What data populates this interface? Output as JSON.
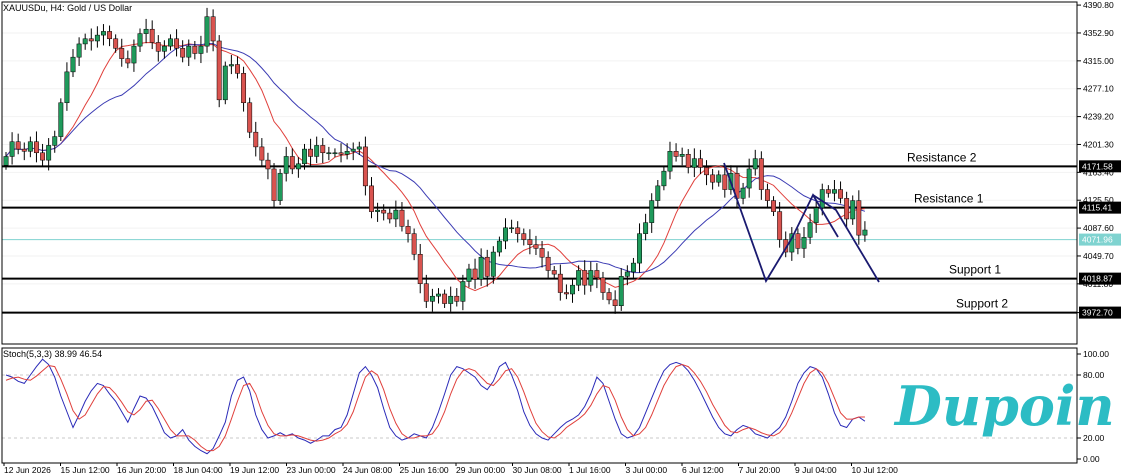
{
  "chart_data": {
    "type": "candlestick",
    "symbol": "XAUUSDu",
    "timeframe": "H4",
    "title": "Gold / US Dollar",
    "ylim": [
      3930,
      4395
    ],
    "y_ticks": [
      "4390.80",
      "4352.90",
      "4315.00",
      "4277.10",
      "4239.20",
      "4201.30",
      "4163.40",
      "4125.50",
      "4087.60",
      "4049.70",
      "4011.80",
      "3972.70"
    ],
    "x_labels": [
      "12 Jun 2026",
      "15 Jun 12:00",
      "16 Jun 20:00",
      "18 Jun 04:00",
      "19 Jun 12:00",
      "23 Jun 00:00",
      "24 Jun 08:00",
      "25 Jun 16:00",
      "29 Jun 00:00",
      "30 Jun 08:00",
      "1 Jul 16:00",
      "3 Jul 00:00",
      "6 Jul 12:00",
      "7 Jul 20:00",
      "9 Jul 04:00",
      "10 Jul 12:00"
    ],
    "current_price": "4071.96",
    "levels": [
      {
        "name": "Resistance 2",
        "value": 4171.58,
        "label": "4171.58"
      },
      {
        "name": "Resistance 1",
        "value": 4115.41,
        "label": "4115.41"
      },
      {
        "name": "Support 1",
        "value": 4018.87,
        "label": "4018.87"
      },
      {
        "name": "Support 2",
        "value": 3972.7,
        "label": "3972.70"
      }
    ],
    "candles_close": [
      4185,
      4205,
      4195,
      4192,
      4205,
      4190,
      4180,
      4200,
      4212,
      4258,
      4300,
      4320,
      4338,
      4345,
      4342,
      4350,
      4355,
      4345,
      4332,
      4318,
      4312,
      4335,
      4352,
      4358,
      4340,
      4328,
      4335,
      4345,
      4332,
      4320,
      4335,
      4325,
      4335,
      4375,
      4342,
      4262,
      4308,
      4310,
      4298,
      4258,
      4218,
      4198,
      4180,
      4168,
      4125,
      4162,
      4185,
      4168,
      4175,
      4195,
      4185,
      4200,
      4190,
      4190,
      4190,
      4188,
      4192,
      4195,
      4198,
      4145,
      4110,
      4112,
      4108,
      4100,
      4112,
      4090,
      4080,
      4052,
      4012,
      3988,
      3995,
      3998,
      3985,
      3995,
      3988,
      4015,
      4032,
      4018,
      4048,
      4022,
      4055,
      4070,
      4088,
      4088,
      4080,
      4072,
      4065,
      4060,
      4048,
      4030,
      4025,
      4000,
      3998,
      4010,
      4030,
      4010,
      4030,
      4020,
      4000,
      3990,
      3982,
      4022,
      4028,
      4040,
      4080,
      4095,
      4125,
      4145,
      4165,
      4192,
      4185,
      4188,
      4170,
      4182,
      4170,
      4160,
      4150,
      4160,
      4140,
      4162,
      4128,
      4142,
      4168,
      4182,
      4140,
      4125,
      4110,
      4072,
      4055,
      4080,
      4060,
      4075,
      4095,
      4115,
      4140,
      4135,
      4140,
      4128,
      4100,
      4125,
      4078,
      4085
    ],
    "ma_fast_name": "MA fast",
    "ma_slow_name": "MA slow",
    "patterns": [
      {
        "name": "zigzag-left",
        "points": [
          [
            124,
            4182
          ],
          [
            130,
            4028
          ],
          [
            135,
            4115
          ],
          [
            138,
            4148
          ],
          [
            143,
            4028
          ]
        ]
      }
    ],
    "stoch": {
      "title": "Stoch(5,3,3) 38.99 46.54",
      "ylim": [
        0,
        100
      ],
      "y_ticks": [
        "100.00",
        "80.00",
        "20.00",
        "0.00"
      ],
      "k": [
        80,
        78,
        74,
        72,
        80,
        88,
        95,
        90,
        78,
        60,
        45,
        30,
        42,
        55,
        65,
        72,
        70,
        62,
        55,
        45,
        35,
        48,
        60,
        58,
        50,
        38,
        25,
        20,
        22,
        28,
        18,
        12,
        8,
        5,
        10,
        22,
        35,
        60,
        75,
        78,
        65,
        42,
        28,
        20,
        22,
        25,
        22,
        24,
        20,
        18,
        15,
        18,
        22,
        22,
        28,
        30,
        42,
        62,
        82,
        88,
        80,
        68,
        48,
        30,
        22,
        18,
        20,
        24,
        22,
        20,
        30,
        45,
        62,
        80,
        88,
        86,
        82,
        78,
        70,
        66,
        74,
        88,
        92,
        80,
        65,
        45,
        32,
        24,
        20,
        18,
        24,
        30,
        35,
        38,
        42,
        50,
        62,
        78,
        72,
        55,
        38,
        24,
        20,
        22,
        30,
        44,
        58,
        72,
        84,
        90,
        92,
        90,
        84,
        75,
        64,
        52,
        40,
        30,
        24,
        22,
        28,
        32,
        30,
        24,
        22,
        20,
        25,
        30,
        40,
        55,
        72,
        82,
        88,
        86,
        78,
        62,
        44,
        32,
        30,
        38,
        40,
        36
      ],
      "d": [
        75,
        77,
        78,
        76,
        75,
        79,
        84,
        89,
        88,
        76,
        62,
        46,
        38,
        42,
        52,
        62,
        69,
        68,
        62,
        54,
        45,
        42,
        47,
        55,
        56,
        48,
        38,
        28,
        22,
        22,
        22,
        18,
        12,
        8,
        8,
        12,
        22,
        38,
        55,
        70,
        72,
        62,
        45,
        32,
        24,
        22,
        22,
        23,
        22,
        20,
        18,
        17,
        18,
        20,
        24,
        27,
        33,
        45,
        62,
        78,
        84,
        80,
        66,
        48,
        34,
        24,
        20,
        20,
        22,
        22,
        24,
        32,
        45,
        62,
        76,
        84,
        86,
        84,
        78,
        72,
        70,
        76,
        84,
        86,
        78,
        64,
        48,
        34,
        26,
        21,
        20,
        24,
        30,
        34,
        38,
        43,
        51,
        62,
        70,
        68,
        56,
        40,
        28,
        22,
        24,
        30,
        42,
        56,
        70,
        80,
        88,
        90,
        88,
        82,
        74,
        64,
        52,
        42,
        32,
        26,
        25,
        28,
        30,
        28,
        25,
        23,
        22,
        25,
        32,
        44,
        58,
        72,
        82,
        86,
        82,
        72,
        58,
        44,
        38,
        38,
        40,
        40
      ]
    }
  },
  "logo": {
    "text": "Dupoin"
  }
}
